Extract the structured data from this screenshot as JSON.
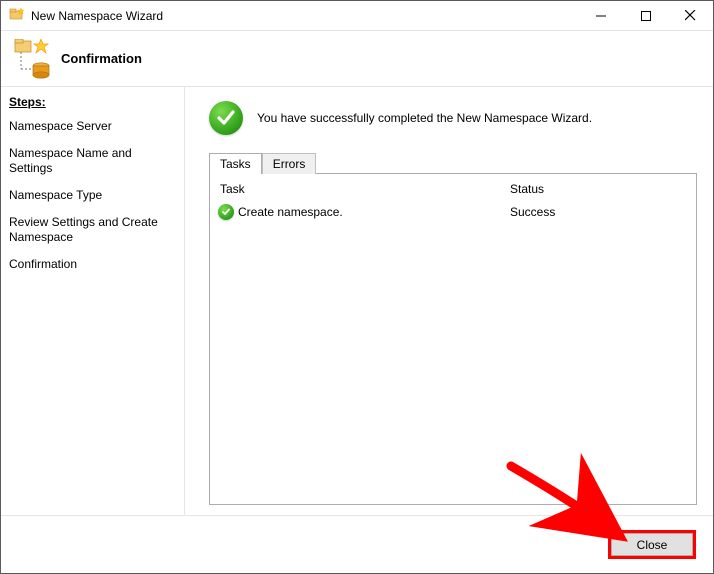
{
  "window": {
    "title": "New Namespace Wizard"
  },
  "header": {
    "heading": "Confirmation"
  },
  "sidebar": {
    "steps_label": "Steps:",
    "items": [
      {
        "label": "Namespace Server"
      },
      {
        "label": "Namespace Name and Settings"
      },
      {
        "label": "Namespace Type"
      },
      {
        "label": "Review Settings and Create Namespace"
      },
      {
        "label": "Confirmation"
      }
    ]
  },
  "main": {
    "success_message": "You have successfully completed the New Namespace Wizard.",
    "tabs": [
      {
        "label": "Tasks",
        "active": true
      },
      {
        "label": "Errors",
        "active": false
      }
    ],
    "columns": {
      "task": "Task",
      "status": "Status"
    },
    "rows": [
      {
        "task": "Create namespace.",
        "status": "Success"
      }
    ]
  },
  "buttons": {
    "close": "Close"
  }
}
